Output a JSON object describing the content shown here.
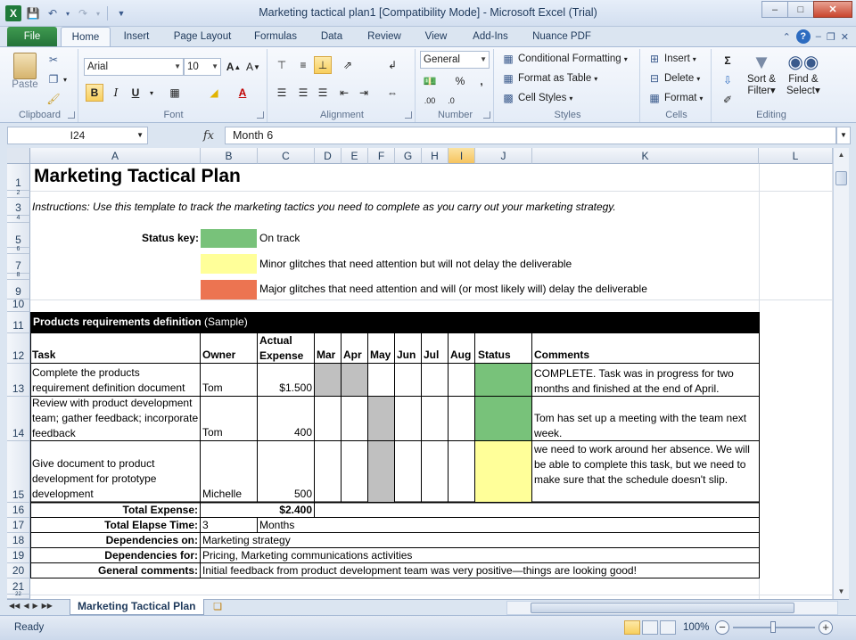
{
  "window": {
    "title": "Marketing tactical plan1  [Compatibility Mode]  -  Microsoft Excel (Trial)",
    "app_icon_letter": "X"
  },
  "tabs": [
    "File",
    "Home",
    "Insert",
    "Page Layout",
    "Formulas",
    "Data",
    "Review",
    "View",
    "Add-Ins",
    "Nuance PDF"
  ],
  "ribbon": {
    "clipboard": {
      "label": "Clipboard",
      "paste": "Paste"
    },
    "font": {
      "label": "Font",
      "name": "Arial",
      "size": "10",
      "bold": "B",
      "italic": "I",
      "underline": "U"
    },
    "alignment": {
      "label": "Alignment"
    },
    "number": {
      "label": "Number",
      "format": "General"
    },
    "styles": {
      "label": "Styles",
      "conditional": "Conditional Formatting",
      "table": "Format as Table",
      "cell": "Cell Styles"
    },
    "cells": {
      "label": "Cells",
      "insert": "Insert",
      "delete": "Delete",
      "format": "Format"
    },
    "editing": {
      "label": "Editing",
      "sort": "Sort &",
      "sort2": "Filter",
      "find": "Find &",
      "find2": "Select"
    }
  },
  "formula_bar": {
    "name_box": "I24",
    "fx": "fx",
    "value": "Month 6"
  },
  "columns": [
    "A",
    "B",
    "C",
    "D",
    "E",
    "F",
    "G",
    "H",
    "I",
    "J",
    "K",
    "L"
  ],
  "rows": [
    "1",
    "2",
    "3",
    "4",
    "5",
    "6",
    "7",
    "8",
    "9",
    "10",
    "11",
    "12",
    "13",
    "14",
    "15",
    "16",
    "17",
    "18",
    "19",
    "20",
    "21",
    "22"
  ],
  "content": {
    "title": "Marketing Tactical Plan",
    "instructions": "Instructions: Use this template to track the marketing tactics you need to complete as you carry out your marketing strategy.",
    "status_key_label": "Status key:",
    "status_keys": [
      {
        "color": "#78c27a",
        "text": "On track"
      },
      {
        "color": "#ffff99",
        "text": "Minor glitches that need attention but will not delay the deliverable"
      },
      {
        "color": "#ec7451",
        "text": "Major glitches that need attention and will (or most likely will) delay the deliverable"
      }
    ],
    "section_title": "Products requirements definition",
    "section_suffix": " (Sample)",
    "headers": {
      "task": "Task",
      "owner": "Owner",
      "expense1": "Actual",
      "expense2": "Expense",
      "months": [
        "Mar",
        "Apr",
        "May",
        "Jun",
        "Jul",
        "Aug"
      ],
      "status": "Status",
      "comments": "Comments"
    },
    "tasks": [
      {
        "task": "Complete the products requirement definition document",
        "owner": "Tom",
        "expense": "$1.500",
        "comments": "COMPLETE. Task was in progress for two months and finished at the end of April.",
        "status_color": "#78c27a"
      },
      {
        "task": "Review with product development team; gather feedback; incorporate feedback",
        "owner": "Tom",
        "expense": "400",
        "comments": "Tom has set up a meeting with the team next week.",
        "status_color": "#78c27a"
      },
      {
        "task": "Give document to product development for prototype development",
        "owner": "Michelle",
        "expense": "500",
        "comments": "we need to work around her absence. We will be able to complete this task, but we need to make sure that the schedule doesn't slip.",
        "status_color": "#ffff99"
      }
    ],
    "summary": [
      {
        "label": "Total Expense:",
        "value": "$2.400",
        "extra": ""
      },
      {
        "label": "Total Elapse Time:",
        "value": "3",
        "extra": "Months"
      },
      {
        "label": "Dependencies on:",
        "value": "Marketing strategy",
        "extra": ""
      },
      {
        "label": "Dependencies for:",
        "value": "Pricing, Marketing communications activities",
        "extra": ""
      },
      {
        "label": "General comments:",
        "value": "Initial feedback from product development team was very positive—things are looking good!",
        "extra": ""
      }
    ]
  },
  "sheet_tab": "Marketing Tactical Plan",
  "status": {
    "ready": "Ready",
    "zoom": "100%"
  },
  "colors": {
    "gantt_gray": "#c0c0c0",
    "header_black": "#000000"
  }
}
